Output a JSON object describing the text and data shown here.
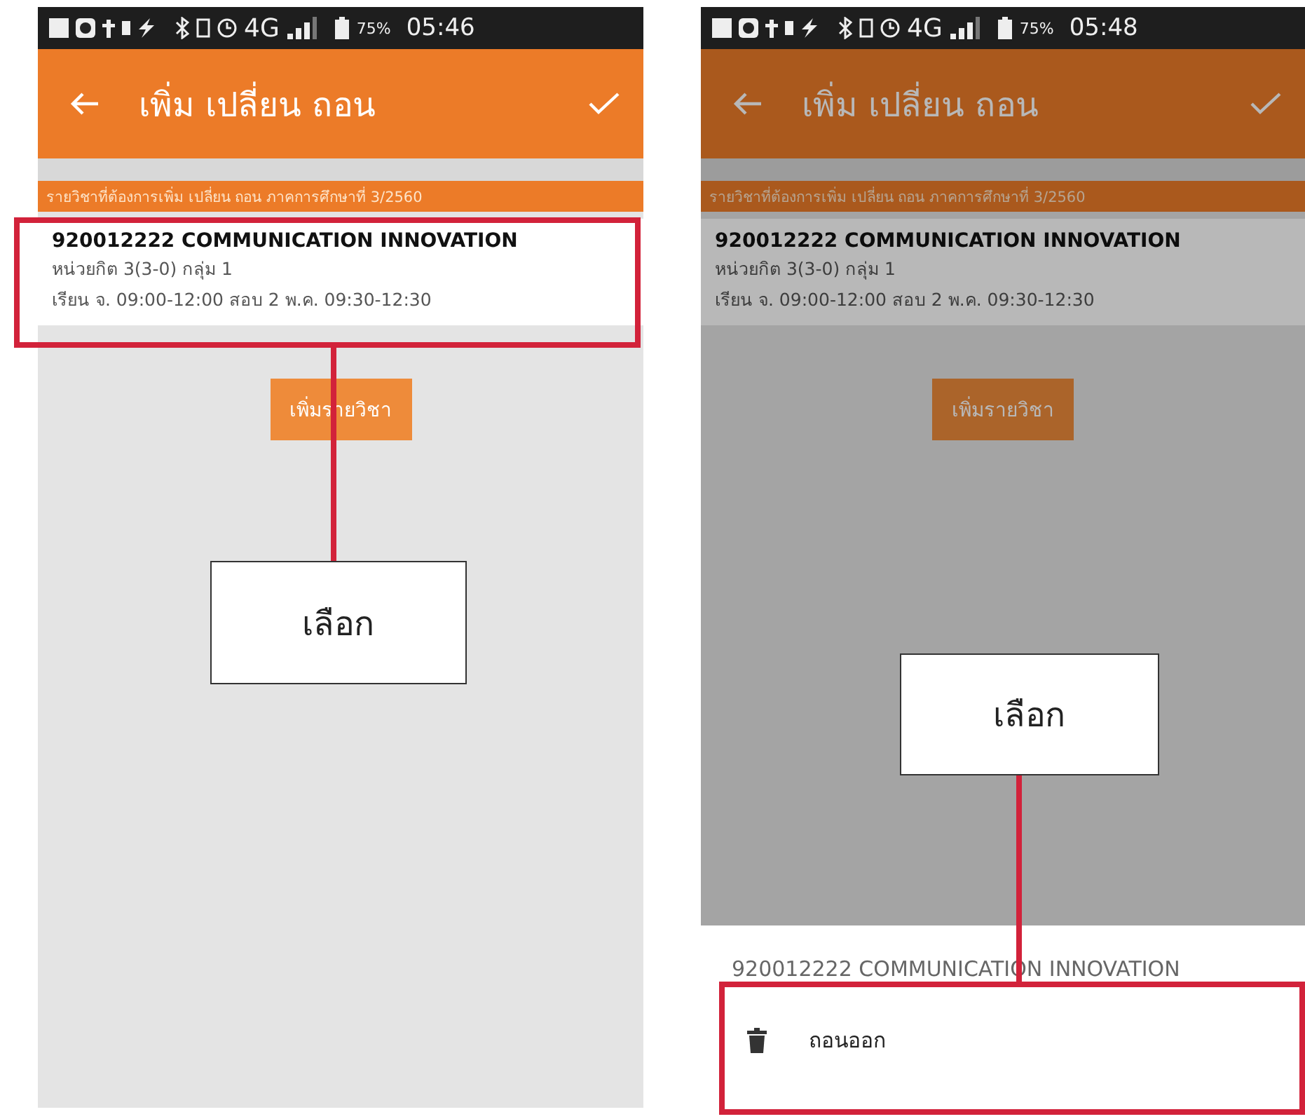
{
  "screens": [
    {
      "dimmed": false,
      "status_bar": {
        "network": "4G",
        "battery": "75%",
        "time": "05:46"
      },
      "app_bar": {
        "title": "เพิ่ม เปลี่ยน ถอน"
      },
      "subtitle": "รายวิชาที่ต้องการเพิ่ม เปลี่ยน ถอน ภาคการศึกษาที่ 3/2560",
      "course": {
        "title": "920012222 COMMUNICATION INNOVATION",
        "credits": "หน่วยกิต 3(3-0) กลุ่ม 1",
        "schedule": "เรียน จ. 09:00-12:00 สอบ 2 พ.ค. 09:30-12:30"
      },
      "add_button": "เพิ่มรายวิชา",
      "callout": "เลือก"
    },
    {
      "dimmed": true,
      "status_bar": {
        "network": "4G",
        "battery": "75%",
        "time": "05:48"
      },
      "app_bar": {
        "title": "เพิ่ม เปลี่ยน ถอน"
      },
      "subtitle": "รายวิชาที่ต้องการเพิ่ม เปลี่ยน ถอน ภาคการศึกษาที่ 3/2560",
      "course": {
        "title": "920012222 COMMUNICATION INNOVATION",
        "credits": "หน่วยกิต 3(3-0) กลุ่ม 1",
        "schedule": "เรียน จ. 09:00-12:00 สอบ 2 พ.ค. 09:30-12:30"
      },
      "add_button": "เพิ่มรายวิชา",
      "callout": "เลือก",
      "bottom_sheet": {
        "title": "920012222 COMMUNICATION INNOVATION",
        "actions": [
          {
            "label": "ถอนออก"
          }
        ]
      }
    }
  ]
}
